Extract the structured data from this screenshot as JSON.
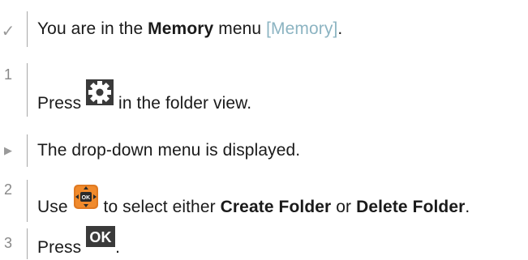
{
  "steps": [
    {
      "marker": "✓",
      "parts": [
        "You are in the ",
        "Memory",
        " menu ",
        "[Memory]",
        "."
      ]
    },
    {
      "marker": "1",
      "parts": [
        "Press ",
        " in the folder view."
      ],
      "icon": "gear-icon"
    },
    {
      "marker": "▶",
      "parts": [
        "The drop-down menu is displayed."
      ]
    },
    {
      "marker": "2",
      "parts": [
        "Use ",
        " to select either ",
        "Create Folder",
        " or ",
        "Delete Folder",
        "."
      ],
      "icon": "ok-navigation-pad-icon"
    },
    {
      "marker": "3",
      "parts": [
        "Press ",
        "."
      ],
      "icon": "ok-key-icon",
      "icon_text": "OK"
    }
  ]
}
